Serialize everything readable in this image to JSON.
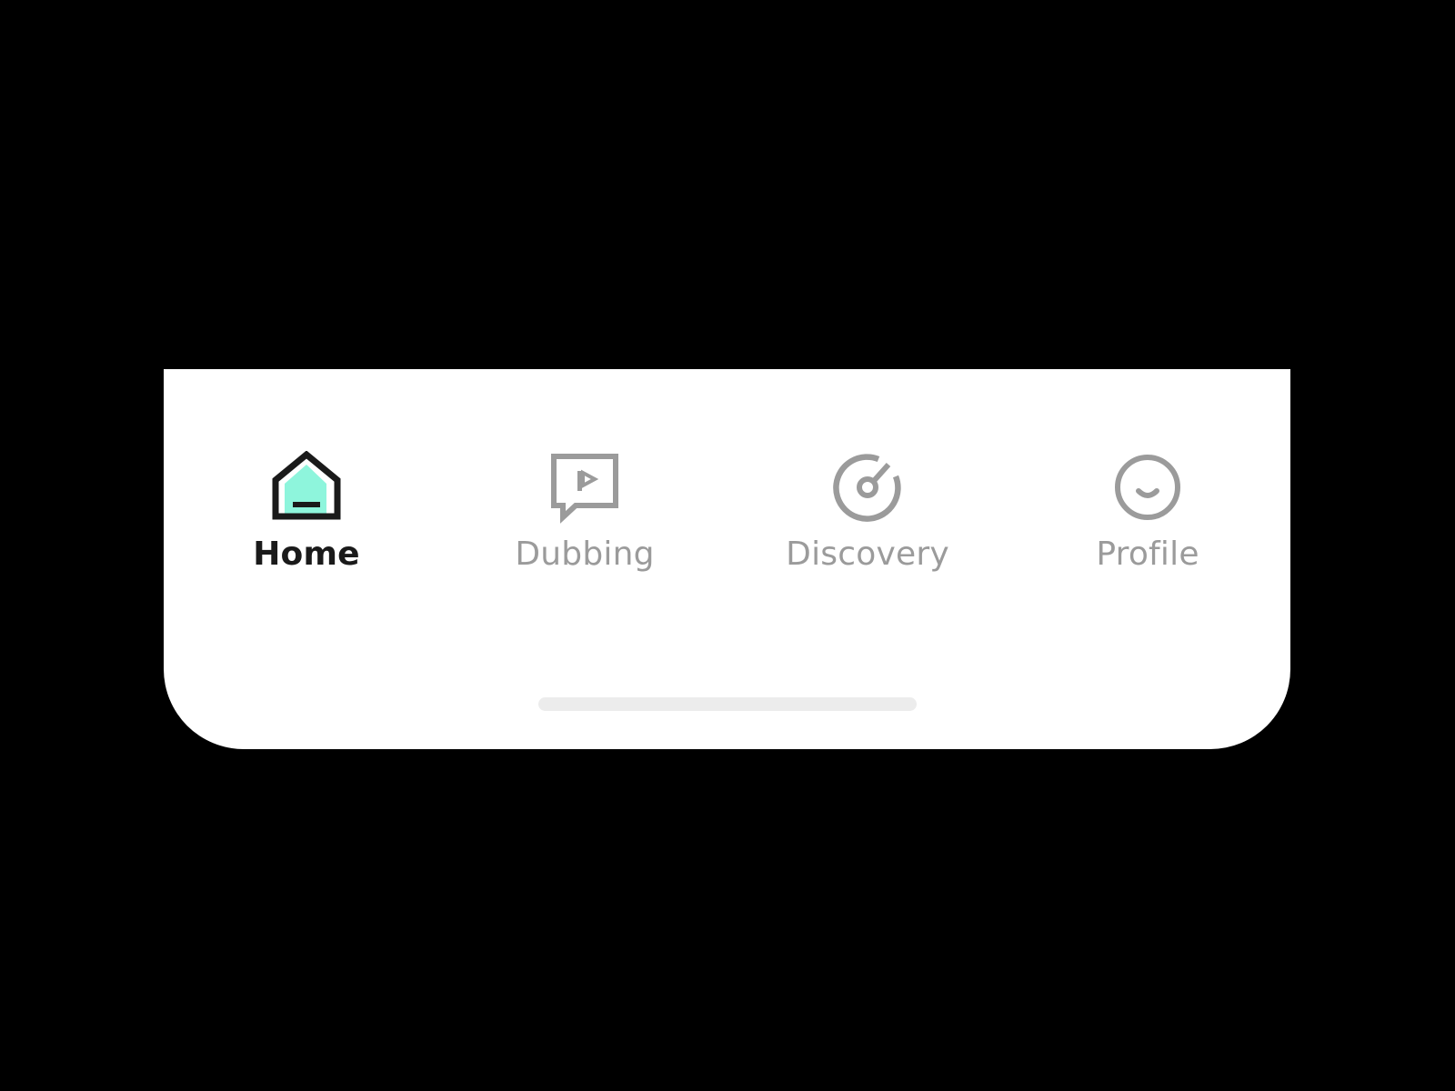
{
  "colors": {
    "background": "#000000",
    "panel": "#ffffff",
    "active_text": "#1a1a1a",
    "inactive": "#9b9b9b",
    "accent": "#8ef5dc",
    "home_indicator": "#ececec"
  },
  "tab_bar": {
    "tabs": [
      {
        "label": "Home",
        "icon": "home-icon",
        "active": true
      },
      {
        "label": "Dubbing",
        "icon": "dubbing-icon",
        "active": false
      },
      {
        "label": "Discovery",
        "icon": "discovery-icon",
        "active": false
      },
      {
        "label": "Profile",
        "icon": "profile-icon",
        "active": false
      }
    ]
  }
}
